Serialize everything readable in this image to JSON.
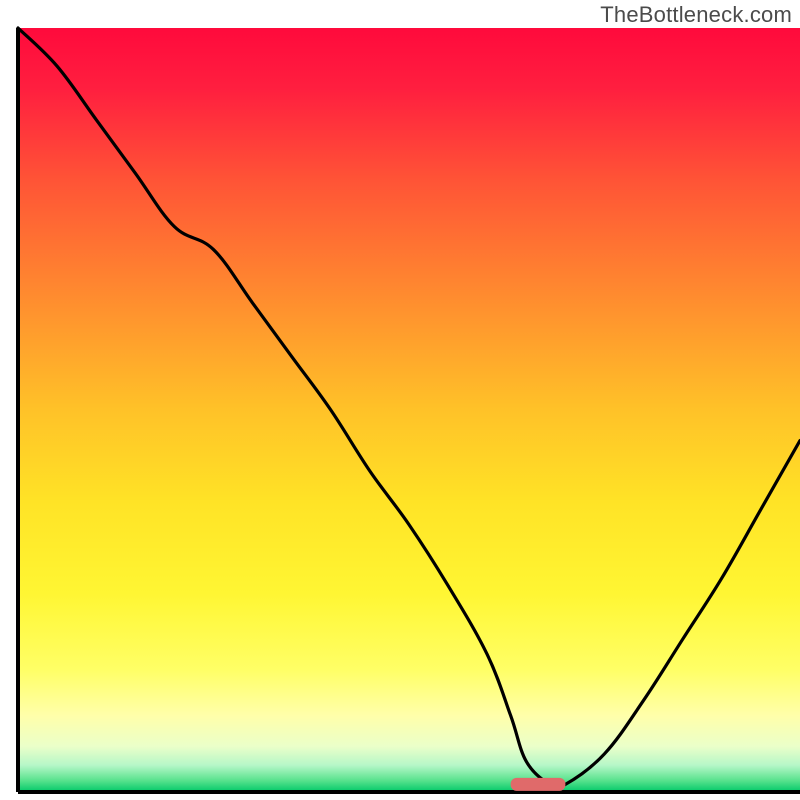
{
  "watermark": "TheBottleneck.com",
  "chart_data": {
    "type": "line",
    "title": "",
    "xlabel": "",
    "ylabel": "",
    "xlim": [
      0,
      100
    ],
    "ylim": [
      0,
      100
    ],
    "x": [
      0,
      5,
      10,
      15,
      20,
      25,
      30,
      35,
      40,
      45,
      50,
      55,
      60,
      63,
      65,
      68,
      70,
      75,
      80,
      85,
      90,
      95,
      100
    ],
    "values": [
      100,
      95,
      88,
      81,
      74,
      71,
      64,
      57,
      50,
      42,
      35,
      27,
      18,
      10,
      4,
      1,
      1,
      5,
      12,
      20,
      28,
      37,
      46
    ],
    "optimal_marker": {
      "x_start": 63,
      "x_end": 70,
      "y": 1
    },
    "gradient_stops": [
      {
        "offset": 0.0,
        "color": "#ff0a3c"
      },
      {
        "offset": 0.08,
        "color": "#ff1f3f"
      },
      {
        "offset": 0.2,
        "color": "#ff5436"
      },
      {
        "offset": 0.35,
        "color": "#ff8b2f"
      },
      {
        "offset": 0.5,
        "color": "#ffc228"
      },
      {
        "offset": 0.62,
        "color": "#ffe326"
      },
      {
        "offset": 0.74,
        "color": "#fff633"
      },
      {
        "offset": 0.84,
        "color": "#ffff66"
      },
      {
        "offset": 0.9,
        "color": "#ffffaa"
      },
      {
        "offset": 0.94,
        "color": "#ebffc9"
      },
      {
        "offset": 0.965,
        "color": "#b6f7c8"
      },
      {
        "offset": 0.985,
        "color": "#58e28d"
      },
      {
        "offset": 1.0,
        "color": "#00c868"
      }
    ],
    "marker_color": "#e06a6a",
    "curve_color": "#000000",
    "axis_color": "#000000"
  }
}
